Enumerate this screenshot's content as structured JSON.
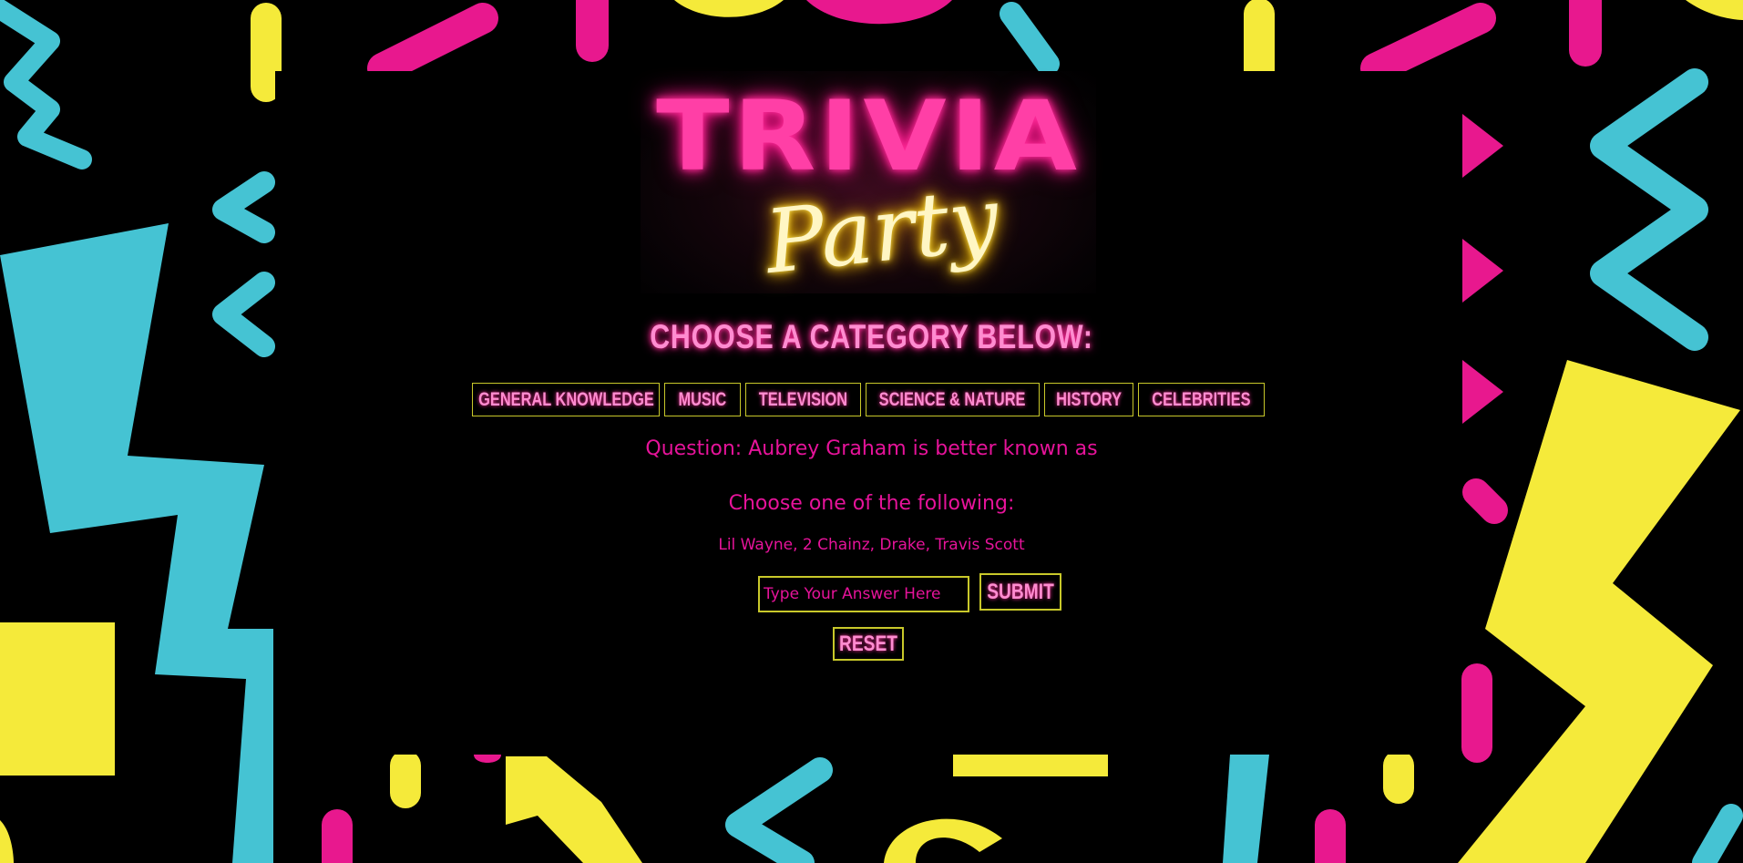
{
  "logo": {
    "title_word": "TRIVIA",
    "script_word": "Party"
  },
  "heading": "CHOOSE A CATEGORY BELOW:",
  "categories": [
    {
      "label": "GENERAL KNOWLEDGE"
    },
    {
      "label": "MUSIC"
    },
    {
      "label": "TELEVISION"
    },
    {
      "label": "SCIENCE & NATURE"
    },
    {
      "label": "HISTORY"
    },
    {
      "label": "CELEBRITIES"
    }
  ],
  "question": "Question: Aubrey Graham is better known as",
  "choose_prompt": "Choose one of the following:",
  "options": "Lil Wayne, 2 Chainz, Drake, Travis Scott",
  "answer_input": {
    "placeholder": "Type Your Answer Here",
    "value": ""
  },
  "submit_label": "SUBMIT",
  "reset_label": "RESET",
  "colors": {
    "background": "#000000",
    "neon_pink": "#ff3fa6",
    "text_pink": "#e6139a",
    "neon_yellow": "#f5ea3a",
    "neon_cyan": "#45c3d3",
    "border_yellow": "#c8c82a"
  }
}
